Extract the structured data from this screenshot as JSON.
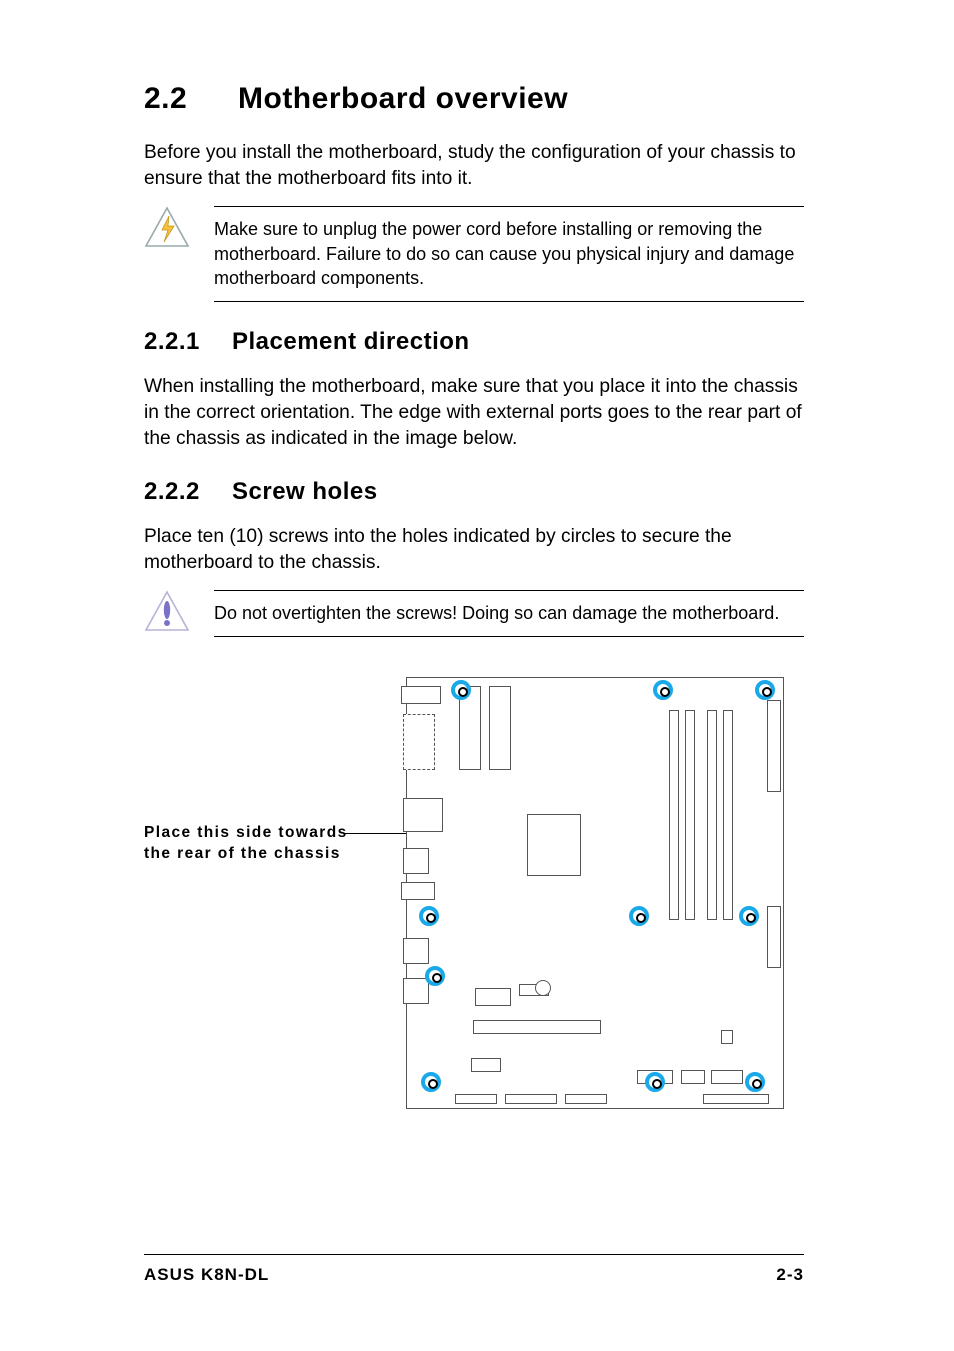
{
  "heading": {
    "number": "2.2",
    "title": "Motherboard overview"
  },
  "intro": "Before you install the motherboard, study the configuration of your chassis to ensure that the motherboard fits into it.",
  "warning1": "Make sure to unplug the power cord before installing or removing the motherboard. Failure to do so can cause you physical injury and damage motherboard components.",
  "sub1": {
    "number": "2.2.1",
    "title": "Placement direction",
    "body": "When installing the motherboard, make sure that you place it into the chassis in the correct orientation. The edge with external ports goes to the rear part of the chassis as indicated in the image below."
  },
  "sub2": {
    "number": "2.2.2",
    "title": "Screw holes",
    "body": "Place ten (10) screws into the holes indicated by circles to secure the motherboard to the chassis."
  },
  "caution": "Do not overtighten the screws! Doing so can damage the motherboard.",
  "diagram_label_line1": "Place this side towards",
  "diagram_label_line2": "the rear of the chassis",
  "footer": {
    "left": "ASUS K8N-DL",
    "right": "2-3"
  }
}
